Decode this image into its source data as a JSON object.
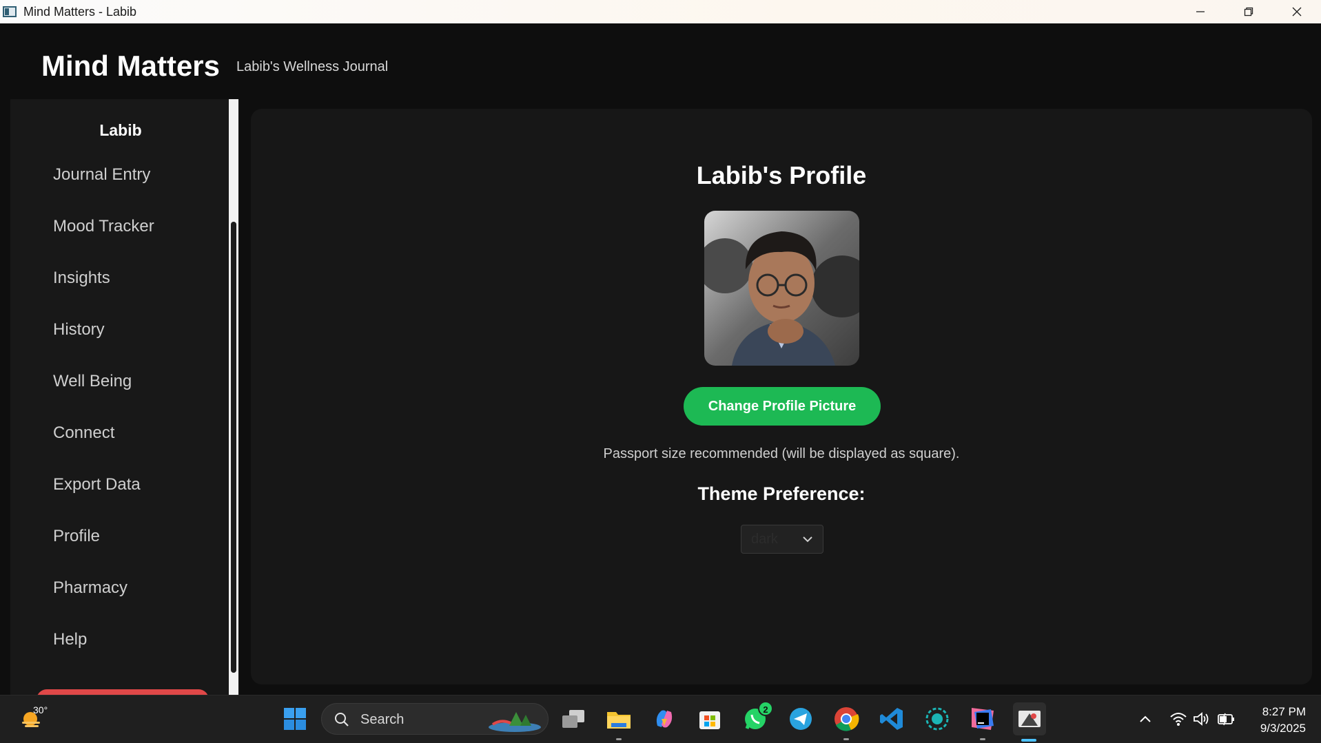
{
  "window": {
    "title": "Mind Matters - Labib"
  },
  "header": {
    "brand": "Mind Matters",
    "subtitle": "Labib's Wellness Journal"
  },
  "sidebar": {
    "user": "Labib",
    "items": [
      {
        "label": "Journal Entry"
      },
      {
        "label": "Mood Tracker"
      },
      {
        "label": "Insights"
      },
      {
        "label": "History"
      },
      {
        "label": "Well Being"
      },
      {
        "label": "Connect"
      },
      {
        "label": "Export Data"
      },
      {
        "label": "Profile"
      },
      {
        "label": "Pharmacy"
      },
      {
        "label": "Help"
      }
    ]
  },
  "profile": {
    "title": "Labib's Profile",
    "avatar_icon": "profile-photo",
    "change_button": "Change Profile Picture",
    "hint": "Passport size recommended (will be displayed as square).",
    "theme_label": "Theme Preference:",
    "theme_value": "dark"
  },
  "taskbar": {
    "weather_temp": "30°",
    "search_label": "Search",
    "whatsapp_badge": "2",
    "time": "8:27 PM",
    "date": "9/3/2025"
  },
  "colors": {
    "accent_green": "#1db954",
    "background": "#0e0e0e",
    "panel": "#171717"
  }
}
